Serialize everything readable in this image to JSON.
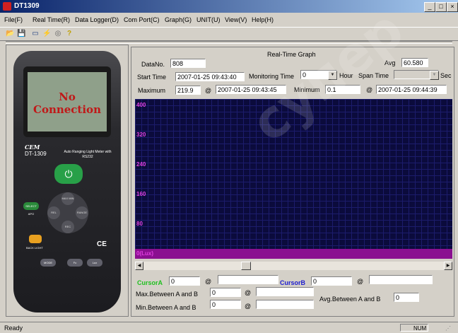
{
  "window": {
    "title": "DT1309",
    "minimize": "_",
    "maximize": "□",
    "close": "×"
  },
  "menu": [
    {
      "label": "File(F)"
    },
    {
      "label": "Real Time(R)"
    },
    {
      "label": "Data Logger(D)"
    },
    {
      "label": "Com Port(C)"
    },
    {
      "label": "Graph(G)"
    },
    {
      "label": "UNIT(U)"
    },
    {
      "label": "View(V)"
    },
    {
      "label": "Help(H)"
    }
  ],
  "toolbar": {
    "icons": [
      "open-icon",
      "save-icon",
      "print-icon",
      "connect-icon",
      "disconnect-icon",
      "help-icon"
    ],
    "glyphs": [
      "📂",
      "💾",
      "▭",
      "⚡",
      "◎",
      "?"
    ]
  },
  "meter": {
    "lcd_text": "No Connection",
    "brand": "CEM",
    "model": "DT-1309",
    "desc": "Auto Ranging Light Meter with RS232",
    "power": "⏻",
    "btn_select": "SELECT APO",
    "btn_max": "MAX MIN",
    "btn_rel": "REL",
    "btn_range": "RANGE",
    "btn_rec": "REC",
    "btn_backlight": "BACK LIGHT",
    "btn_mode": "MODE",
    "btn_fc": "Fc",
    "btn_lux": "Lux",
    "ce": "CE"
  },
  "graph": {
    "frame_title": "Real-Time Graph",
    "data_no_label": "DataNo.",
    "data_no": "808",
    "avg_label": "Avg",
    "avg": "60.580",
    "start_time_label": "Start Time",
    "start_time": "2007-01-25 09:43:40",
    "monitoring_label": "Monitoring Time",
    "monitoring_value": "0",
    "hour_label": "Hour",
    "span_label": "Span Time",
    "span_value": "",
    "sec_label": "Sec",
    "max_label": "Maximum",
    "max_value": "219.9",
    "at": "@",
    "max_time": "2007-01-25 09:43:45",
    "min_label": "Minimum",
    "min_value": "0.1",
    "min_time": "2007-01-25 09:44:39",
    "y_ticks": [
      "400",
      "320",
      "240",
      "160",
      "80",
      "0(Lux)"
    ]
  },
  "cursor": {
    "a_label": "CursorA",
    "a_value": "0",
    "a_time": "",
    "b_label": "CursorB",
    "b_value": "0",
    "b_time": "",
    "max_ab_label": "Max.Between A and B",
    "max_ab_value": "0",
    "max_ab_time": "",
    "min_ab_label": "Min.Between A and B",
    "min_ab_value": "0",
    "min_ab_time": "",
    "avg_ab_label": "Avg.Between A and B",
    "avg_ab_value": "0",
    "a_color": "#20c020",
    "b_color": "#2020d0"
  },
  "status": {
    "text": "Ready",
    "num": "NUM"
  },
  "watermark": "супер"
}
